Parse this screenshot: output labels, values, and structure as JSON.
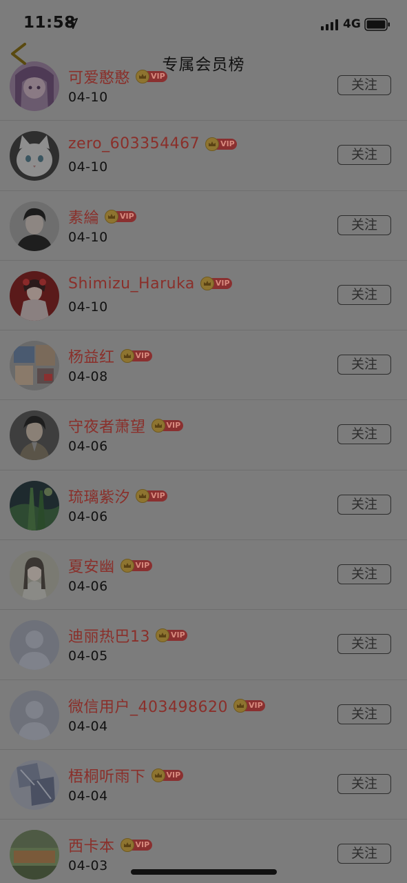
{
  "status_bar": {
    "time": "11:58",
    "network": "4G"
  },
  "header": {
    "title": "专属会员榜"
  },
  "vip_label": "VIP",
  "follow_label": "关注",
  "members": [
    {
      "name": "可爱憨憨",
      "date": "04-10",
      "avatar": "anime-girl"
    },
    {
      "name": "zero_603354467",
      "date": "04-10",
      "avatar": "white-cat"
    },
    {
      "name": "素綸",
      "date": "04-10",
      "avatar": "anime-boy"
    },
    {
      "name": "Shimizu_Haruka",
      "date": "04-10",
      "avatar": "red-kimono"
    },
    {
      "name": "杨益红",
      "date": "04-08",
      "avatar": "photo-collage"
    },
    {
      "name": "守夜者萧望",
      "date": "04-06",
      "avatar": "dark-anime"
    },
    {
      "name": "琉璃紫汐",
      "date": "04-06",
      "avatar": "green-scene"
    },
    {
      "name": "夏安幽",
      "date": "04-06",
      "avatar": "portrait-woman"
    },
    {
      "name": "迪丽热巴13",
      "date": "04-05",
      "avatar": "default"
    },
    {
      "name": "微信用户_403498620",
      "date": "04-04",
      "avatar": "default"
    },
    {
      "name": "梧桐听雨下",
      "date": "04-04",
      "avatar": "sketch"
    },
    {
      "name": "西卡本",
      "date": "04-03",
      "avatar": "study-sign"
    }
  ]
}
